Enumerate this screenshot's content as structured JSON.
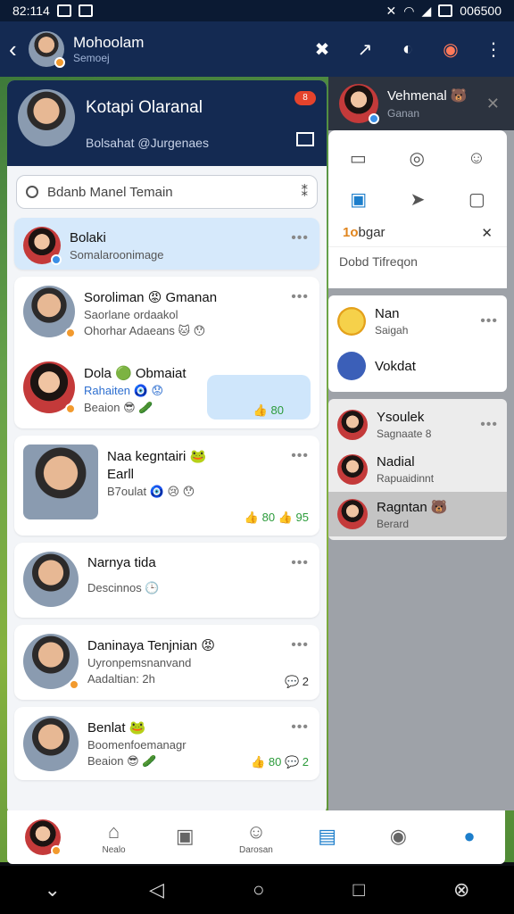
{
  "status_bar": {
    "time": "82:114",
    "right_text": "006500"
  },
  "app_bar": {
    "title": "Mohoolam",
    "subtitle": "Semoej"
  },
  "left_panel": {
    "header": {
      "name": "Kotapi Olaranal",
      "sub": "Bolsahat @Jurgenaes",
      "badge": "8"
    },
    "search": {
      "placeholder": "Bdanb Manel Temain"
    },
    "chats": [
      {
        "name": "Bolaki",
        "line1": "Somalaroonimage",
        "selected": true
      },
      {
        "name": "Soroliman 😡 Gmanan",
        "line1": "Saorlane ordaakol",
        "line2": "Ohorhar Adaeans 🐱 😯"
      },
      {
        "name": "Dola 🟢 Obmaiat",
        "line1": "Rahaiten 🧿 😟",
        "line2": "Beaion 😎 🥒",
        "reactions": "👍 80"
      },
      {
        "name": "Naa kegntairi 🐸",
        "line1": "Earll",
        "line2": "B7oulat 🧿 😢 😯",
        "reactions": "👍 80 👍 95"
      },
      {
        "name": "Narnya tida",
        "line1": "Descinnos 🕒"
      },
      {
        "name": "Daninaya Tenjnian 😡",
        "line1": "Uyronpemsnanvand",
        "line2": "Aadaltian: 2h",
        "reactions": "💬 2"
      },
      {
        "name": "Benlat 🐸",
        "line1": "Boomenfoemanagr",
        "line2": "Beaion 😎 🥒",
        "reactions": "👍 80 💬 2"
      }
    ]
  },
  "right_panel": {
    "header": {
      "name": "Vehmenal 🐻",
      "sub": "Ganan"
    },
    "tools": {
      "title_prefix": "1o",
      "title": "bgar",
      "subtitle": "Dobd Tifreqon"
    },
    "items": [
      {
        "name": "Nan",
        "line1": "Saigah"
      },
      {
        "name": "Vokdat",
        "line1": ""
      },
      {
        "name": "Ysoulek",
        "line1": "Sagnaate 8"
      },
      {
        "name": "Nadial",
        "line1": "Rapuaidinnt"
      },
      {
        "name": "Ragntan 🐻",
        "line1": "Berard"
      }
    ]
  },
  "bottom_nav": {
    "items": [
      "",
      "Nealo",
      "",
      "Darosan",
      "",
      "",
      ""
    ]
  }
}
